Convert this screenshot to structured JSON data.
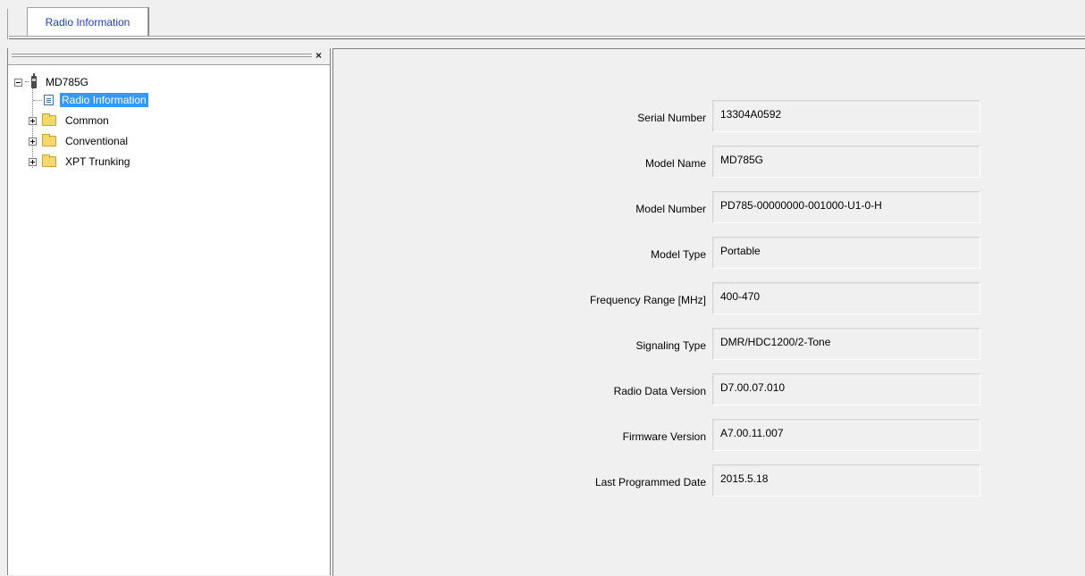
{
  "tabs": [
    {
      "label": "Radio Information",
      "active": true
    }
  ],
  "tree": {
    "root": "MD785G",
    "children": [
      {
        "label": "Radio Information",
        "selected": true,
        "icon": "document-icon"
      },
      {
        "label": "Common",
        "icon": "folder-icon"
      },
      {
        "label": "Conventional",
        "icon": "folder-icon"
      },
      {
        "label": "XPT Trunking",
        "icon": "folder-icon"
      }
    ]
  },
  "panel": {
    "close_glyph": "×"
  },
  "fields": [
    {
      "label": "Serial Number",
      "value": "13304A0592"
    },
    {
      "label": "Model Name",
      "value": "MD785G"
    },
    {
      "label": "Model Number",
      "value": "PD785-00000000-001000-U1-0-H"
    },
    {
      "label": "Model Type",
      "value": "Portable"
    },
    {
      "label": "Frequency Range [MHz]",
      "value": "400-470"
    },
    {
      "label": "Signaling Type",
      "value": "DMR/HDC1200/2-Tone"
    },
    {
      "label": "Radio Data Version",
      "value": "D7.00.07.010"
    },
    {
      "label": "Firmware Version",
      "value": "A7.00.11.007"
    },
    {
      "label": "Last Programmed Date",
      "value": "2015.5.18"
    }
  ],
  "colors": {
    "tab_text": "#1a3fbf",
    "selection": "#3399ff",
    "folder": "#f6d76b"
  }
}
